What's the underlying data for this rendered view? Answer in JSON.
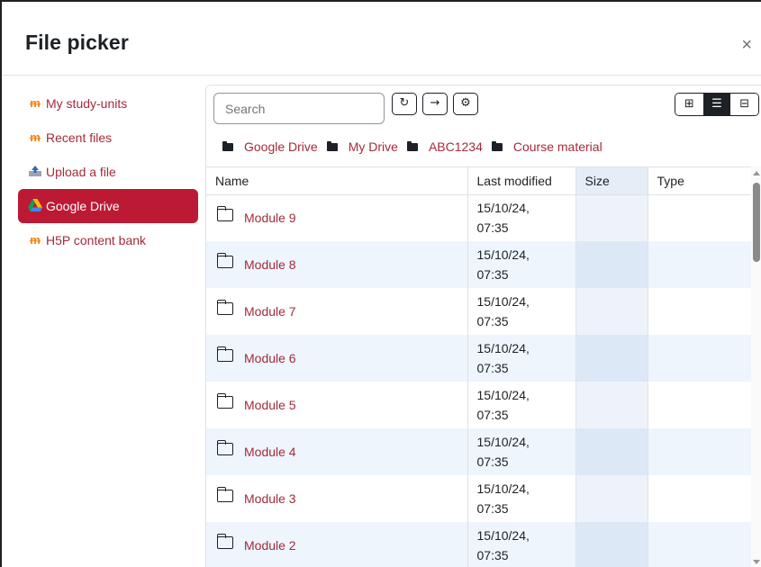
{
  "dialog": {
    "title": "File picker",
    "close_label": "×"
  },
  "sidebar": {
    "items": [
      {
        "label": "My study-units",
        "icon": "moodle-icon",
        "active": false
      },
      {
        "label": "Recent files",
        "icon": "moodle-icon",
        "active": false
      },
      {
        "label": "Upload a file",
        "icon": "upload-icon",
        "active": false
      },
      {
        "label": "Google Drive",
        "icon": "google-drive-icon",
        "active": true
      },
      {
        "label": "H5P content bank",
        "icon": "moodle-icon",
        "active": false
      }
    ]
  },
  "toolbar": {
    "search_placeholder": "Search",
    "refresh_icon": "↻",
    "logout_icon": "→",
    "settings_icon": "⚙",
    "view_icons": "⊞",
    "view_list": "☰",
    "view_tree": "⊟"
  },
  "breadcrumbs": [
    "Google Drive",
    "My Drive",
    "ABC1234",
    "Course material"
  ],
  "table": {
    "headers": {
      "name": "Name",
      "modified": "Last modified",
      "size": "Size",
      "type": "Type"
    },
    "rows": [
      {
        "name": "Module 9",
        "date": "15/10/24,",
        "time": "07:35"
      },
      {
        "name": "Module 8",
        "date": "15/10/24,",
        "time": "07:35"
      },
      {
        "name": "Module 7",
        "date": "15/10/24,",
        "time": "07:35"
      },
      {
        "name": "Module 6",
        "date": "15/10/24,",
        "time": "07:35"
      },
      {
        "name": "Module 5",
        "date": "15/10/24,",
        "time": "07:35"
      },
      {
        "name": "Module 4",
        "date": "15/10/24,",
        "time": "07:35"
      },
      {
        "name": "Module 3",
        "date": "15/10/24,",
        "time": "07:35"
      },
      {
        "name": "Module 2",
        "date": "15/10/24,",
        "time": "07:35"
      }
    ]
  },
  "colors": {
    "accent": "#bc1a34",
    "link": "#a52a3a",
    "stripe": "#eef5fd"
  }
}
